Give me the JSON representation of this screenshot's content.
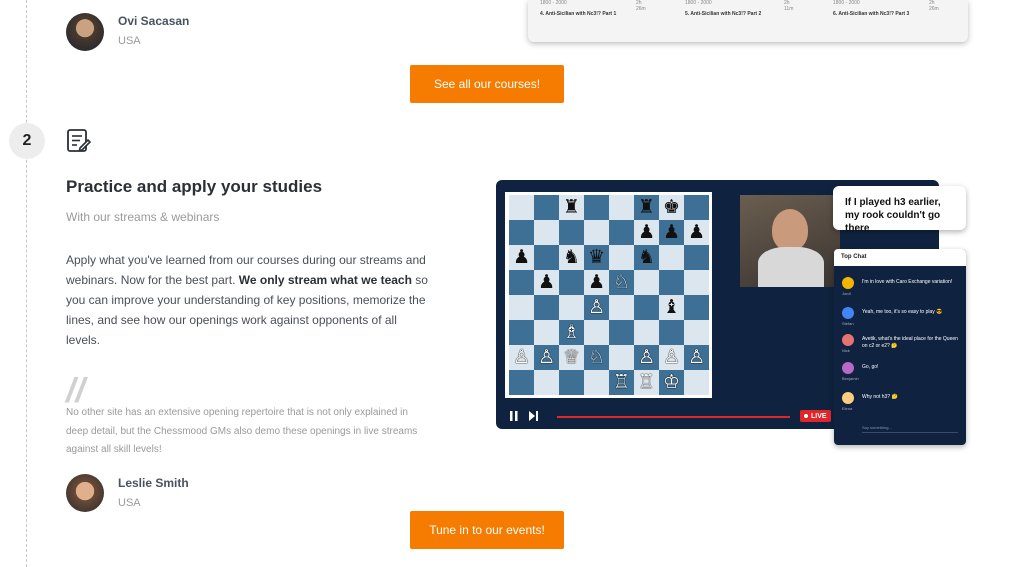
{
  "top_testimonial": {
    "name": "Ovi Sacasan",
    "country": "USA"
  },
  "courses": [
    {
      "meta": "1800 - 2000",
      "duration": "2h 26m",
      "title": "4. Anti-Sicilian with Nc3!? Part 1"
    },
    {
      "meta": "1800 - 2000",
      "duration": "2h 11m",
      "title": "5. Anti-Sicilian with Nc3!? Part 2"
    },
    {
      "meta": "1800 - 2000",
      "duration": "2h 26m",
      "title": "6. Anti-Sicilian with Nc3!? Part 3"
    }
  ],
  "buttons": {
    "see_courses": "See all our courses!",
    "tune_in": "Tune in to our events!"
  },
  "step": {
    "number": "2",
    "title": "Practice and apply your studies",
    "subtitle": "With our streams & webinars",
    "para_1": "Apply what you've learned from our courses during our streams and webinars. Now for the best part. ",
    "para_bold": "We only stream what we teach",
    "para_2": " so you can improve your understanding of key positions, memorize the lines, and see how our openings work against opponents of all levels.",
    "quote_mark": "//",
    "quote": "No other site has an extensive opening repertoire that is not only explained in deep detail, but the Chessmood GMs also demo these openings in live streams against all skill levels!",
    "author": "Leslie Smith",
    "author_country": "USA"
  },
  "video": {
    "live_label": "LIVE",
    "bubble": "If I played h3 earlier, my rook couldn't go there"
  },
  "chat": {
    "title": "Top Chat",
    "messages": [
      {
        "text": "I'm in love with Caro Exchange variation!",
        "user": "Jordi",
        "color": "#f4b400"
      },
      {
        "text": "Yeah, me too, it's so easy to play 😎",
        "user": "Stefan",
        "color": "#4285f4"
      },
      {
        "text": "Avetik, what's the ideal place for the Queen on c2 or e2? 🤔",
        "user": "Nick",
        "color": "#e57373"
      },
      {
        "text": "Go, go!",
        "user": "Benjamin",
        "color": "#ba68c8"
      },
      {
        "text": "Why not h3? 🤔",
        "user": "Elena",
        "color": "#ffcc80"
      }
    ],
    "input_placeholder": "Say something..."
  },
  "colors": {
    "accent": "#f57c00",
    "board_dark": "#3e6f94",
    "board_light": "#dce6ef"
  },
  "board": [
    [
      "",
      "",
      "♜",
      "",
      "",
      "♜",
      "♚",
      ""
    ],
    [
      "",
      "",
      "",
      "",
      "",
      "♟",
      "♟",
      "♟"
    ],
    [
      "♟",
      "",
      "♞",
      "♛",
      "",
      "♞",
      "",
      ""
    ],
    [
      "",
      "♟",
      "",
      "♟",
      "♘",
      "",
      "",
      ""
    ],
    [
      "",
      "",
      "",
      "♙",
      "",
      "",
      "♝",
      ""
    ],
    [
      "",
      "",
      "♗",
      "",
      "",
      "",
      "",
      ""
    ],
    [
      "♙",
      "♙",
      "♕",
      "♘",
      "",
      "♙",
      "♙",
      "♙"
    ],
    [
      "",
      "",
      "",
      "",
      "♖",
      "♖",
      "♔",
      ""
    ]
  ]
}
